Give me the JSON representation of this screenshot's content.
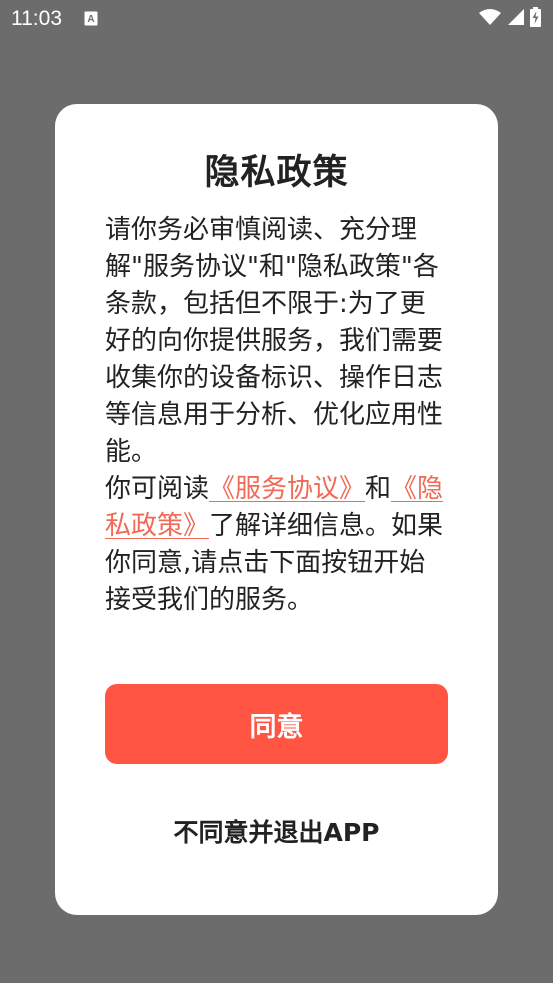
{
  "status_bar": {
    "time": "11:03",
    "notification_icon": "a-notification-icon",
    "wifi_icon": "wifi-icon",
    "signal_icon": "signal-icon",
    "battery_icon": "battery-charging-icon"
  },
  "dialog": {
    "title": "隐私政策",
    "body_intro": "请你务必审慎阅读、充分理解\"服务协议\"和\"隐私政策\"各条款，包括但不限于:为了更好的向你提供服务，我们需要收集你的设备标识、操作日志等信息用于分析、优化应用性能。",
    "read_prefix": "你可阅读",
    "service_link": "《服务协议》",
    "and_text": "和",
    "privacy_link": "《隐私政策》",
    "read_suffix": "了解详细信息。如果你同意,请点击下面按钮开始接受我们的服务。",
    "agree_label": "同意",
    "exit_label": "不同意并退出APP"
  },
  "colors": {
    "accent": "#ff5542",
    "link": "#f06a55",
    "scrim": "#6c6c6c"
  }
}
